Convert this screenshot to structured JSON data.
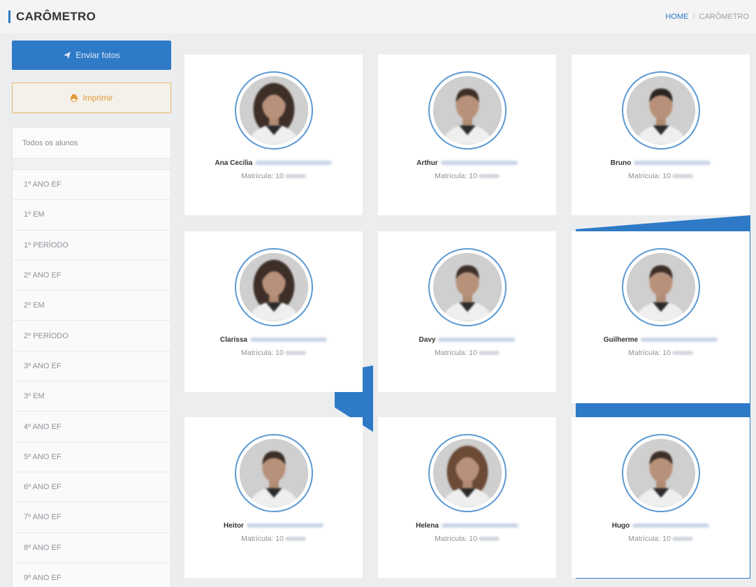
{
  "header": {
    "title": "CARÔMETRO",
    "breadcrumb_home": "HOME",
    "breadcrumb_separator": "/",
    "breadcrumb_current": "CARÔMETRO"
  },
  "sidebar": {
    "send_photos_label": "Enviar fotos",
    "print_label": "Imprimir",
    "all_students_label": "Todos os alunos",
    "classes": [
      "1º ANO EF",
      "1º EM",
      "1º PERÍODO",
      "2º ANO EF",
      "2º EM",
      "2º PERÍODO",
      "3º ANO EF",
      "3º EM",
      "4º ANO EF",
      "5º ANO EF",
      "6º ANO EF",
      "7º ANO EF",
      "8º ANO EF",
      "9º ANO EF"
    ]
  },
  "students": [
    {
      "first_name": "Ana Cecília",
      "enrollment_label": "Matrícula:",
      "enrollment": "10",
      "hair": "long-dark"
    },
    {
      "first_name": "Arthur",
      "enrollment_label": "Matrícula:",
      "enrollment": "10",
      "hair": "short"
    },
    {
      "first_name": "Bruno",
      "enrollment_label": "Matrícula:",
      "enrollment": "10",
      "hair": "short-dark"
    },
    {
      "first_name": "Clarissa",
      "enrollment_label": "Matrícula:",
      "enrollment": "10",
      "hair": "long-dark"
    },
    {
      "first_name": "Davy",
      "enrollment_label": "Matrícula:",
      "enrollment": "10",
      "hair": "short"
    },
    {
      "first_name": "Guilherme",
      "enrollment_label": "Matrícula:",
      "enrollment": "10",
      "hair": "short"
    },
    {
      "first_name": "Heitor",
      "enrollment_label": "Matrícula:",
      "enrollment": "10",
      "hair": "short"
    },
    {
      "first_name": "Helena",
      "enrollment_label": "Matrícula:",
      "enrollment": "10",
      "hair": "long-light"
    },
    {
      "first_name": "Hugo",
      "enrollment_label": "Matrícula:",
      "enrollment": "10",
      "hair": "short"
    }
  ],
  "colors": {
    "primary": "#2e7ac7",
    "print_border": "#e5b86d",
    "print_text": "#e39a3b"
  }
}
